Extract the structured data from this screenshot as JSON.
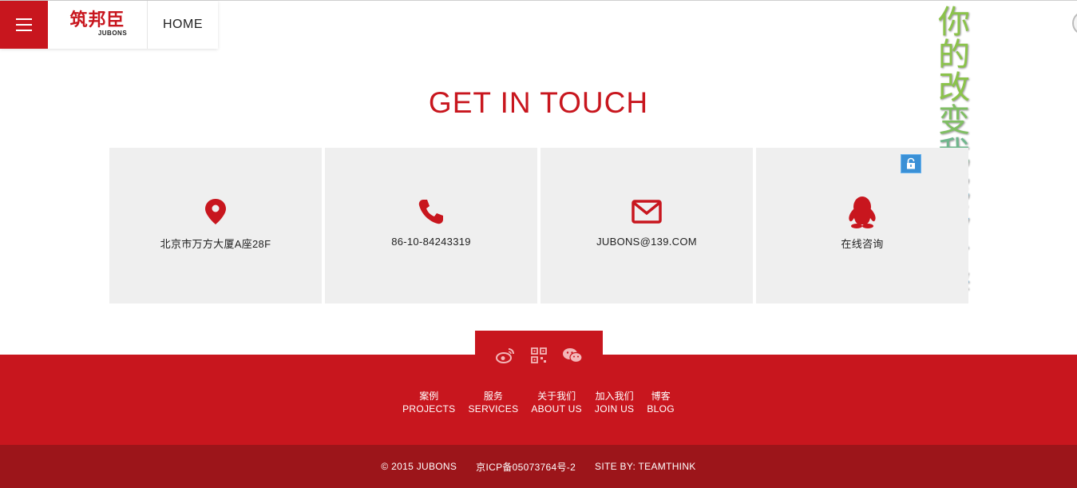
{
  "header": {
    "logo_cn": "筑邦臣",
    "logo_en": "JUBONS",
    "home_label": "HOME"
  },
  "overlay_text": [
    "你",
    "的",
    "改",
    "变",
    "我",
    "能",
    "够",
    "分",
    "辨"
  ],
  "section_title": "GET IN TOUCH",
  "contacts": [
    {
      "icon": "location-pin-icon",
      "label": "北京市万方大厦A座28F"
    },
    {
      "icon": "phone-icon",
      "label": "86-10-84243319"
    },
    {
      "icon": "envelope-icon",
      "label": "JUBONS@139.COM"
    },
    {
      "icon": "qq-penguin-icon",
      "label": "在线咨询"
    }
  ],
  "social_icons": [
    "weibo-icon",
    "qr-code-icon",
    "wechat-icon"
  ],
  "footer_nav": [
    {
      "cn": "案例",
      "en": "PROJECTS"
    },
    {
      "cn": "服务",
      "en": "SERVICES"
    },
    {
      "cn": "关于我们",
      "en": "ABOUT US"
    },
    {
      "cn": "加入我们",
      "en": "JOIN US"
    },
    {
      "cn": "博客",
      "en": "BLOG"
    }
  ],
  "footer_bottom": {
    "copyright": "© 2015 JUBONS",
    "icp": "京ICP备05073764号-2",
    "site_by": "SITE BY: TEAMTHINK"
  },
  "colors": {
    "brand_red": "#c8161e",
    "footer_dark_red": "#9c151a",
    "card_bg": "#efefef"
  }
}
